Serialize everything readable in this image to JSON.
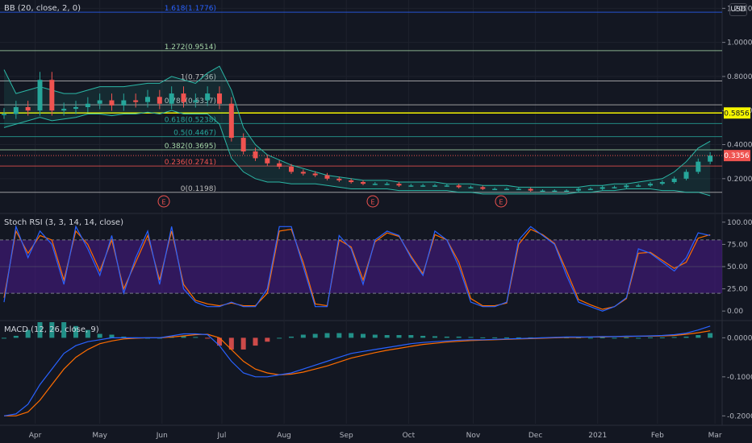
{
  "currency": "USD",
  "price_pane": {
    "label": "BB (20, close, 2, 0)"
  },
  "stoch_pane": {
    "label": "Stoch RSI (3, 3, 14, 14, close)"
  },
  "macd_pane": {
    "label": "MACD (12, 26, close, 9)"
  },
  "colors": {
    "background": "#131722",
    "grid": "#1e222d",
    "up": "#26a69a",
    "down": "#ef5350",
    "bb": "#2bb7a6",
    "stoch_k": "#2962ff",
    "stoch_d": "#ff6d00",
    "stoch_band": "#4a1a8c",
    "macd_line": "#2962ff",
    "signal_line": "#ff6d00",
    "fib_236": "#ef5350",
    "fib_1618": "#2962ff",
    "fib_1272": "#a5d6a7",
    "fib_0618": "#26a69a",
    "fib_0786": "#bdbdbd",
    "last_price": "#ef5350",
    "highlight": "#f5f500"
  },
  "chart_data": [
    {
      "type": "line",
      "name": "price",
      "x_ticks": [
        "Apr",
        "May",
        "Jun",
        "Jul",
        "Aug",
        "Sep",
        "Oct",
        "Nov",
        "Dec",
        "2021",
        "Feb",
        "Mar"
      ],
      "y_ticks": [
        "1.2000",
        "1.0000",
        "0.8000",
        "0.6000",
        "0.4000",
        "0.2000"
      ],
      "ylim": [
        0.01,
        1.23
      ],
      "x": [
        0,
        5,
        10,
        15,
        20,
        25,
        30,
        35,
        40,
        45,
        50,
        55,
        60,
        65,
        70,
        75,
        80,
        85,
        90,
        95,
        100,
        105,
        110,
        115,
        120,
        125,
        130,
        135,
        140,
        145,
        150,
        155,
        160,
        165,
        170,
        175,
        180,
        185,
        190,
        195,
        200,
        205,
        210,
        215,
        220,
        225,
        230,
        235,
        240,
        245,
        250,
        255,
        260,
        265,
        270,
        275,
        280,
        285,
        290,
        295
      ],
      "values": [
        0.58,
        0.62,
        0.6,
        0.78,
        0.6,
        0.61,
        0.62,
        0.64,
        0.66,
        0.63,
        0.66,
        0.65,
        0.68,
        0.64,
        0.7,
        0.65,
        0.66,
        0.7,
        0.64,
        0.44,
        0.36,
        0.32,
        0.29,
        0.27,
        0.24,
        0.23,
        0.22,
        0.2,
        0.19,
        0.18,
        0.17,
        0.17,
        0.17,
        0.16,
        0.16,
        0.16,
        0.16,
        0.16,
        0.15,
        0.15,
        0.14,
        0.14,
        0.14,
        0.14,
        0.13,
        0.13,
        0.13,
        0.13,
        0.14,
        0.14,
        0.15,
        0.15,
        0.16,
        0.16,
        0.17,
        0.18,
        0.2,
        0.24,
        0.3,
        0.3356
      ],
      "bb_upper": [
        0.84,
        0.7,
        0.72,
        0.74,
        0.72,
        0.7,
        0.7,
        0.72,
        0.74,
        0.74,
        0.74,
        0.75,
        0.76,
        0.76,
        0.8,
        0.78,
        0.76,
        0.82,
        0.86,
        0.72,
        0.5,
        0.4,
        0.34,
        0.31,
        0.28,
        0.26,
        0.24,
        0.22,
        0.21,
        0.2,
        0.19,
        0.19,
        0.19,
        0.18,
        0.18,
        0.18,
        0.18,
        0.17,
        0.17,
        0.17,
        0.16,
        0.16,
        0.16,
        0.15,
        0.15,
        0.15,
        0.15,
        0.15,
        0.15,
        0.16,
        0.16,
        0.17,
        0.17,
        0.18,
        0.19,
        0.2,
        0.24,
        0.3,
        0.38,
        0.42
      ],
      "bb_lower": [
        0.5,
        0.52,
        0.54,
        0.56,
        0.54,
        0.55,
        0.56,
        0.58,
        0.58,
        0.57,
        0.58,
        0.58,
        0.59,
        0.58,
        0.6,
        0.58,
        0.58,
        0.58,
        0.52,
        0.32,
        0.24,
        0.2,
        0.18,
        0.18,
        0.17,
        0.17,
        0.17,
        0.16,
        0.15,
        0.14,
        0.14,
        0.14,
        0.14,
        0.13,
        0.13,
        0.13,
        0.13,
        0.13,
        0.12,
        0.12,
        0.11,
        0.11,
        0.11,
        0.11,
        0.11,
        0.11,
        0.11,
        0.11,
        0.12,
        0.12,
        0.13,
        0.13,
        0.14,
        0.14,
        0.14,
        0.13,
        0.13,
        0.12,
        0.12,
        0.1
      ],
      "fib_levels": [
        {
          "label": "1.618(1.1776)",
          "value": 1.1776
        },
        {
          "label": "1.272(0.9514)",
          "value": 0.9514
        },
        {
          "label": "1(0.7736)",
          "value": 0.7736
        },
        {
          "label": "0.786(0.6337)",
          "value": 0.6337
        },
        {
          "label": "0.618(0.5238)",
          "value": 0.5238
        },
        {
          "label": "0.5(0.4467)",
          "value": 0.4467
        },
        {
          "label": "0.382(0.3695)",
          "value": 0.3695
        },
        {
          "label": "0.236(0.2741)",
          "value": 0.2741
        },
        {
          "label": "0(0.1198)",
          "value": 0.1198
        }
      ],
      "highlighted_price": "0.5856",
      "last_price": "0.3356",
      "earnings_marker": "E"
    },
    {
      "type": "line",
      "name": "stoch_rsi",
      "y_ticks": [
        "100.00",
        "75.00",
        "50.00",
        "25.00",
        "0.00"
      ],
      "ylim": [
        -8,
        108
      ],
      "band": [
        20,
        80
      ],
      "x": [
        0,
        5,
        10,
        15,
        20,
        25,
        30,
        35,
        40,
        45,
        50,
        55,
        60,
        65,
        70,
        75,
        80,
        85,
        90,
        95,
        100,
        105,
        110,
        115,
        120,
        125,
        130,
        135,
        140,
        145,
        150,
        155,
        160,
        165,
        170,
        175,
        180,
        185,
        190,
        195,
        200,
        205,
        210,
        215,
        220,
        225,
        230,
        235,
        240,
        245,
        250,
        255,
        260,
        265,
        270,
        275,
        280,
        285,
        290,
        295
      ],
      "k": [
        10,
        95,
        60,
        90,
        75,
        30,
        95,
        70,
        40,
        85,
        20,
        60,
        90,
        30,
        95,
        25,
        10,
        5,
        5,
        10,
        5,
        5,
        25,
        95,
        95,
        50,
        5,
        5,
        85,
        70,
        30,
        80,
        90,
        85,
        60,
        40,
        90,
        80,
        50,
        10,
        5,
        5,
        10,
        80,
        95,
        85,
        75,
        40,
        10,
        5,
        0,
        5,
        15,
        70,
        65,
        55,
        45,
        60,
        88,
        85
      ],
      "d": [
        15,
        90,
        65,
        85,
        80,
        35,
        90,
        75,
        45,
        80,
        25,
        55,
        85,
        35,
        90,
        30,
        12,
        8,
        6,
        9,
        6,
        6,
        20,
        90,
        92,
        55,
        8,
        6,
        80,
        72,
        35,
        78,
        88,
        84,
        62,
        42,
        86,
        80,
        55,
        14,
        6,
        6,
        9,
        75,
        92,
        86,
        76,
        45,
        13,
        7,
        2,
        5,
        14,
        65,
        66,
        57,
        48,
        55,
        82,
        86
      ]
    },
    {
      "type": "line",
      "name": "macd",
      "y_ticks": [
        "0.0000",
        "-0.1000",
        "-0.2000"
      ],
      "ylim": [
        -0.22,
        0.04
      ],
      "x": [
        0,
        5,
        10,
        15,
        20,
        25,
        30,
        35,
        40,
        45,
        50,
        55,
        60,
        65,
        70,
        75,
        80,
        85,
        90,
        95,
        100,
        105,
        110,
        115,
        120,
        125,
        130,
        135,
        140,
        145,
        150,
        155,
        160,
        165,
        170,
        175,
        180,
        185,
        190,
        195,
        200,
        205,
        210,
        215,
        220,
        225,
        230,
        235,
        240,
        245,
        250,
        255,
        260,
        265,
        270,
        275,
        280,
        285,
        290,
        295
      ],
      "macd": [
        -0.2,
        -0.195,
        -0.17,
        -0.12,
        -0.08,
        -0.04,
        -0.02,
        -0.01,
        -0.005,
        0,
        0,
        0,
        0,
        0,
        0.005,
        0.01,
        0.01,
        0.008,
        -0.02,
        -0.06,
        -0.09,
        -0.1,
        -0.1,
        -0.095,
        -0.09,
        -0.08,
        -0.07,
        -0.06,
        -0.05,
        -0.04,
        -0.035,
        -0.03,
        -0.025,
        -0.02,
        -0.015,
        -0.012,
        -0.01,
        -0.008,
        -0.006,
        -0.005,
        -0.005,
        -0.004,
        -0.003,
        -0.002,
        -0.001,
        0,
        0.001,
        0.002,
        0.002,
        0.002,
        0.003,
        0.003,
        0.004,
        0.004,
        0.005,
        0.006,
        0.008,
        0.012,
        0.02,
        0.03
      ],
      "signal": [
        -0.2,
        -0.2,
        -0.19,
        -0.16,
        -0.12,
        -0.08,
        -0.05,
        -0.03,
        -0.015,
        -0.008,
        -0.003,
        -0.001,
        0,
        0,
        0.002,
        0.005,
        0.008,
        0.009,
        0.0,
        -0.03,
        -0.06,
        -0.08,
        -0.09,
        -0.095,
        -0.093,
        -0.088,
        -0.08,
        -0.072,
        -0.062,
        -0.052,
        -0.045,
        -0.038,
        -0.032,
        -0.027,
        -0.022,
        -0.017,
        -0.014,
        -0.011,
        -0.009,
        -0.007,
        -0.006,
        -0.005,
        -0.004,
        -0.003,
        -0.002,
        -0.001,
        0,
        0.001,
        0.001,
        0.002,
        0.002,
        0.003,
        0.003,
        0.004,
        0.004,
        0.005,
        0.006,
        0.009,
        0.013,
        0.018
      ]
    }
  ]
}
